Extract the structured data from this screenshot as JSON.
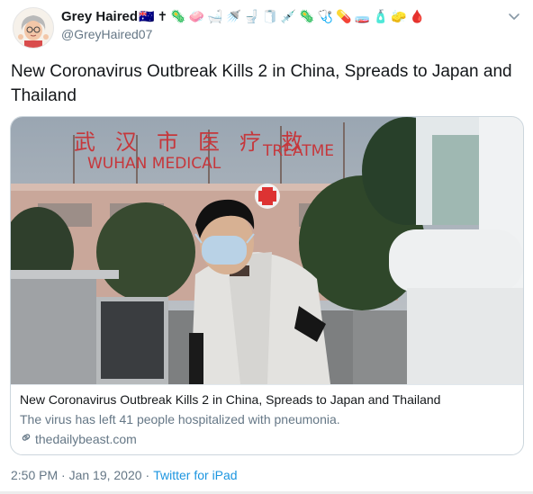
{
  "tweet": {
    "display_name": "Grey Haired",
    "handle": "@GreyHaired07",
    "name_emojis": [
      {
        "name": "flag-australia-icon",
        "glyph": "🇦🇺"
      },
      {
        "name": "latin-cross-icon",
        "glyph": "✝"
      },
      {
        "name": "virus-icon",
        "glyph": "🦠"
      },
      {
        "name": "soap-icon",
        "glyph": "🧼"
      },
      {
        "name": "bathtub-icon",
        "glyph": "🛁"
      },
      {
        "name": "shower-icon",
        "glyph": "🚿"
      },
      {
        "name": "toilet-icon",
        "glyph": "🚽"
      },
      {
        "name": "toilet-paper-icon",
        "glyph": "🧻"
      },
      {
        "name": "syringe-icon",
        "glyph": "💉"
      },
      {
        "name": "virus-icon-2",
        "glyph": "🦠"
      },
      {
        "name": "stethoscope-icon",
        "glyph": "🩺"
      },
      {
        "name": "pill-icon",
        "glyph": "💊"
      },
      {
        "name": "petri-dish-icon",
        "glyph": "🧫"
      },
      {
        "name": "lotion-bottle-icon",
        "glyph": "🧴"
      },
      {
        "name": "sponge-icon",
        "glyph": "🧽"
      },
      {
        "name": "blood-drop-icon",
        "glyph": "🩸"
      }
    ],
    "text": "New Coronavirus Outbreak Kills 2 in China, Spreads to Japan and Thailand",
    "timestamp": "2:50 PM · Jan 19, 2020",
    "separator": "·",
    "source": "Twitter for iPad"
  },
  "card": {
    "image_sign_chinese": "武汉市医疗救",
    "image_sign_english_1": "WUHAN MEDICAL",
    "image_sign_english_2": "TREATME",
    "title": "New Coronavirus Outbreak Kills 2 in China, Spreads to Japan and Thailand",
    "description": "The virus has left 41 people hospitalized with pneumonia.",
    "domain": "thedailybeast.com"
  },
  "colors": {
    "text": "#14171a",
    "secondary": "#657786",
    "link": "#1b95e0",
    "border": "#ccd6dd"
  }
}
